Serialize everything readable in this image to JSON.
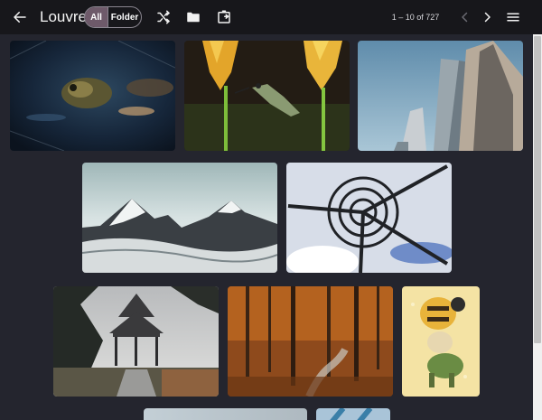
{
  "app": {
    "title": "Louvre"
  },
  "toolbar": {
    "back_icon": "arrow-left-icon",
    "filter_all_label": "All",
    "filter_folder_label": "Folder",
    "shuffle_icon": "shuffle-icon",
    "folder_icon": "folder-icon",
    "move_icon": "move-to-folder-icon",
    "pagination_text": "1 – 10 of 727",
    "prev_icon": "chevron-left-icon",
    "next_icon": "chevron-right-icon",
    "menu_icon": "hamburger-menu-icon"
  },
  "gallery": {
    "items": [
      {
        "subject": "frog in pond"
      },
      {
        "subject": "hummingbird and red hot poker flowers"
      },
      {
        "subject": "skyscrapers"
      },
      {
        "subject": "snowy mountains"
      },
      {
        "subject": "spiral sculpture against sky"
      },
      {
        "subject": "gazebo"
      },
      {
        "subject": "autumn forest path"
      },
      {
        "subject": "illustration of bee and character"
      },
      {
        "subject": "partial image"
      },
      {
        "subject": "partial image"
      }
    ]
  },
  "colors": {
    "topbar": "#17171b",
    "background": "#24252e",
    "toggle_active": "#6e5a6a"
  }
}
